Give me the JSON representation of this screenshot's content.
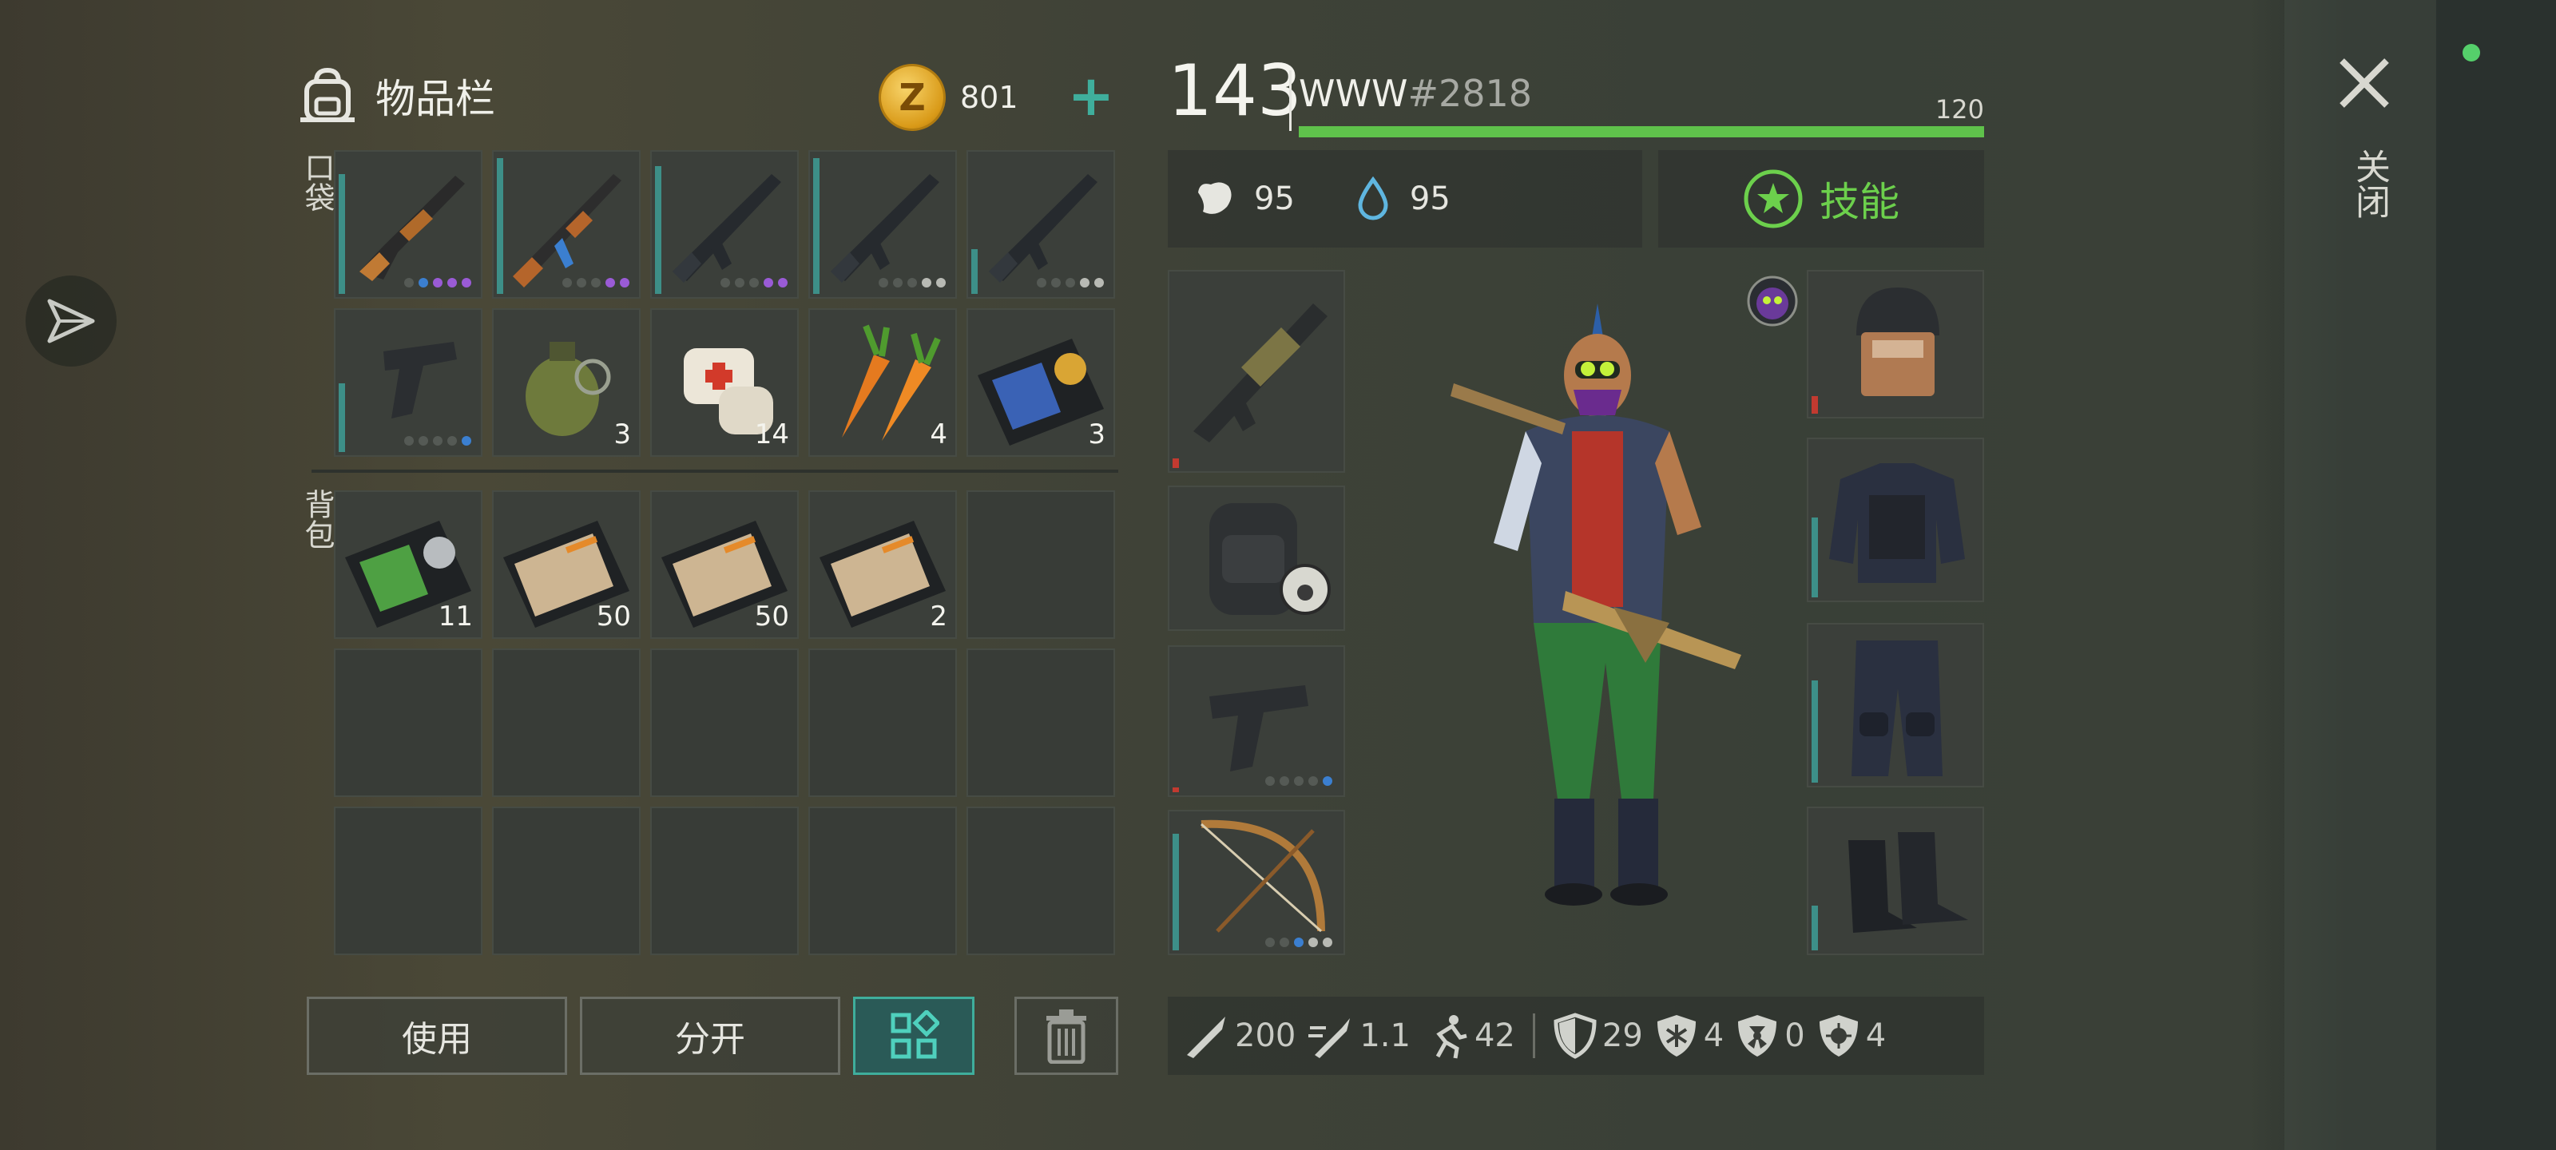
{
  "inventory": {
    "title": "物品栏",
    "coins": "801",
    "plus_label": "+",
    "pocket_label": "口袋",
    "backpack_label": "背包",
    "pocket_slots": [
      {
        "item": "shotgun-icon",
        "count": "",
        "durability": 0.8
      },
      {
        "item": "ak-rifle-icon",
        "count": "",
        "durability": 0.9
      },
      {
        "item": "m16-rifle-icon",
        "count": "",
        "durability": 0.85
      },
      {
        "item": "m16-rifle-icon",
        "count": "",
        "durability": 0.9
      },
      {
        "item": "m16-rifle-icon",
        "count": "",
        "durability": 0.3
      },
      {
        "item": "pistol-icon",
        "count": "",
        "durability": 0.5
      },
      {
        "item": "grenade-icon",
        "count": "3"
      },
      {
        "item": "bandage-icon",
        "count": "14"
      },
      {
        "item": "carrot-icon",
        "count": "4"
      },
      {
        "item": "police-id-card-icon",
        "count": "3"
      }
    ],
    "backpack_slots": [
      {
        "item": "sheriff-id-card-icon",
        "count": "11"
      },
      {
        "item": "patrol-officer-card-icon",
        "count": "50"
      },
      {
        "item": "patrol-officer-card-icon",
        "count": "50"
      },
      {
        "item": "patrol-officer-card-icon",
        "count": "2"
      },
      {
        "item": "",
        "count": ""
      },
      {
        "item": "",
        "count": ""
      },
      {
        "item": "",
        "count": ""
      },
      {
        "item": "",
        "count": ""
      },
      {
        "item": "",
        "count": ""
      },
      {
        "item": "",
        "count": ""
      },
      {
        "item": "",
        "count": ""
      },
      {
        "item": "",
        "count": ""
      },
      {
        "item": "",
        "count": ""
      },
      {
        "item": "",
        "count": ""
      },
      {
        "item": "",
        "count": ""
      }
    ],
    "buttons": {
      "use": "使用",
      "split": "分开"
    }
  },
  "player": {
    "level": "143",
    "name": "WWW",
    "tag": "#2818",
    "xp_value": "120",
    "xp_progress": 1.0,
    "hunger": "95",
    "thirst": "95",
    "skills_label": "技能"
  },
  "equipment": {
    "weapons": [
      "grenade-launcher-icon",
      "backpack-icon",
      "pistol-icon",
      "bow-icon"
    ],
    "armor": [
      "helmet-icon",
      "vest-icon",
      "pants-icon",
      "boots-icon"
    ]
  },
  "stats": [
    {
      "icon": "damage-icon",
      "value": "200"
    },
    {
      "icon": "attack-speed-icon",
      "value": "1.1"
    },
    {
      "icon": "speed-icon",
      "value": "42"
    },
    {
      "icon": "armor-icon",
      "value": "29"
    },
    {
      "icon": "cold-resist-icon",
      "value": "4"
    },
    {
      "icon": "radiation-resist-icon",
      "value": "0"
    },
    {
      "icon": "infection-resist-icon",
      "value": "4"
    }
  ],
  "close_label": "关闭",
  "colors": {
    "accent": "#3fae9c",
    "xp": "#5fc24b",
    "skill": "#6cd04c"
  }
}
